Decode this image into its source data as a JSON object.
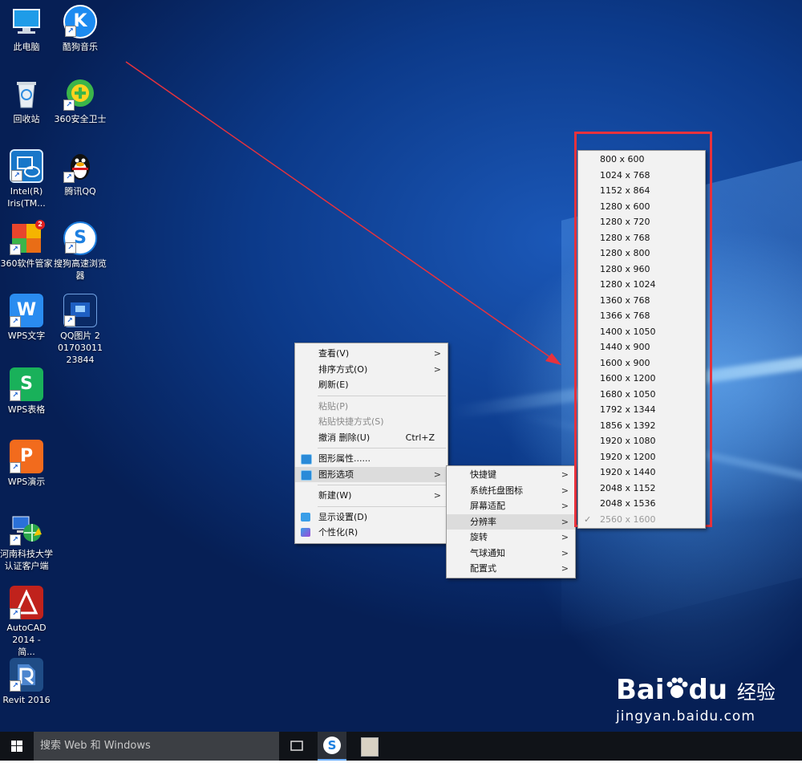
{
  "desktop_icons": [
    {
      "label": "此电脑"
    },
    {
      "label": "酷狗音乐"
    },
    {
      "label": "回收站"
    },
    {
      "label": "360安全卫士"
    },
    {
      "label": "Intel(R) Iris(TM..."
    },
    {
      "label": "腾讯QQ"
    },
    {
      "label": "360软件管家",
      "badge": "2"
    },
    {
      "label": "搜狗高速浏览器"
    },
    {
      "label": "WPS文字"
    },
    {
      "label": "QQ图片 20170301123844"
    },
    {
      "label": "WPS表格"
    },
    {
      "label": "WPS演示"
    },
    {
      "label": "河南科技大学认证客户端"
    },
    {
      "label": "AutoCAD 2014 - 简..."
    },
    {
      "label": "Revit 2016"
    }
  ],
  "context_menu": {
    "view": "查看(V)",
    "sort": "排序方式(O)",
    "refresh": "刷新(E)",
    "paste": "粘贴(P)",
    "paste_shortcut": "粘贴快捷方式(S)",
    "undo_delete": "撤消 删除(U)",
    "undo_shortcut": "Ctrl+Z",
    "graphics_properties": "图形属性......",
    "graphics_options": "图形选项",
    "new": "新建(W)",
    "display_settings": "显示设置(D)",
    "personalize": "个性化(R)"
  },
  "graphics_submenu": {
    "items": [
      "快捷键",
      "系统托盘图标",
      "屏幕适配",
      "分辨率",
      "旋转",
      "气球通知",
      "配置式"
    ],
    "highlighted": "分辨率"
  },
  "resolution_menu": {
    "items": [
      "800 x 600",
      "1024 x 768",
      "1152 x 864",
      "1280 x 600",
      "1280 x 720",
      "1280 x 768",
      "1280 x 800",
      "1280 x 960",
      "1280 x 1024",
      "1360 x 768",
      "1366 x 768",
      "1400 x 1050",
      "1440 x 900",
      "1600 x 900",
      "1600 x 1200",
      "1680 x 1050",
      "1792 x 1344",
      "1856 x 1392",
      "1920 x 1080",
      "1920 x 1200",
      "1920 x 1440",
      "2048 x 1152",
      "2048 x 1536",
      "2560 x 1600"
    ],
    "selected": "2560 x 1600",
    "highlight_color": "#e8323c"
  },
  "taskbar": {
    "search_placeholder": "搜索 Web 和 Windows"
  },
  "watermark": {
    "brand": "Bai",
    "brand2": "du",
    "cn": "经验",
    "url": "jingyan.baidu.com"
  }
}
